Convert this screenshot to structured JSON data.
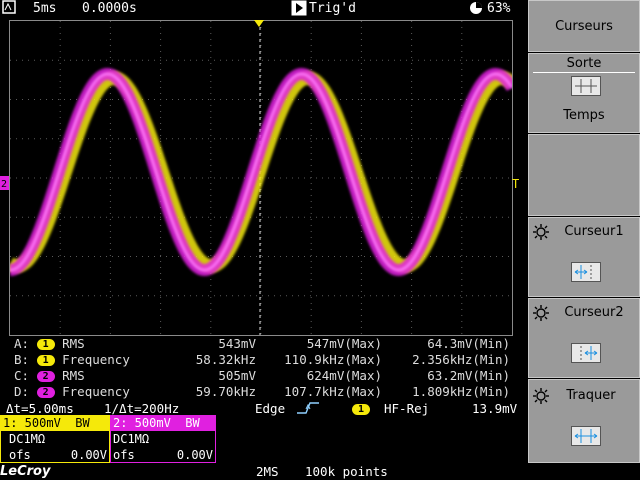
{
  "status": {
    "timebase": "5ms",
    "delay": "0.0000s",
    "trigger_state": "Trig'd",
    "battery": "63%"
  },
  "measurements": [
    {
      "letter": "A:",
      "channel": "1",
      "name": "RMS",
      "value": "543mV",
      "max": "547mV(Max)",
      "min": "64.3mV(Min)",
      "color": "#f5e90a"
    },
    {
      "letter": "B:",
      "channel": "1",
      "name": "Frequency",
      "value": "58.32kHz",
      "max": "110.9kHz(Max)",
      "min": "2.356kHz(Min)",
      "color": "#f5e90a"
    },
    {
      "letter": "C:",
      "channel": "2",
      "name": "RMS",
      "value": "505mV",
      "max": "624mV(Max)",
      "min": "63.2mV(Min)",
      "color": "#e020e0"
    },
    {
      "letter": "D:",
      "channel": "2",
      "name": "Frequency",
      "value": "59.70kHz",
      "max": "107.7kHz(Max)",
      "min": "1.809kHz(Min)",
      "color": "#e020e0"
    }
  ],
  "cursor_info": {
    "delta_t": "Δt=5.00ms",
    "inv_delta_t": "1/Δt=200Hz"
  },
  "trigger": {
    "type": "Edge",
    "source": "1",
    "coupling": "HF-Rej",
    "level": "13.9mV"
  },
  "channels": [
    {
      "header": "1: 500mV  BW",
      "coupling": "DC1MΩ",
      "offset_label": "ofs",
      "offset": "0.00V",
      "color": "#f5e90a"
    },
    {
      "header": "2: 500mV  BW",
      "coupling": "DC1MΩ",
      "offset_label": "ofs",
      "offset": "0.00V",
      "color": "#e020e0"
    }
  ],
  "brand": "LeCroy",
  "acquisition": {
    "sample_rate": "2MS",
    "points": "100k points"
  },
  "softkeys": {
    "title": "Curseurs",
    "type_label": "Sorte",
    "type_value": "Temps",
    "cursor1": "Curseur1",
    "cursor2": "Curseur2",
    "track": "Traquer"
  },
  "colors": {
    "ch1": "#f5e90a",
    "ch2": "#e020e0",
    "trigger_marker": "#f5e90a",
    "softkey_bg": "#9a9a9a"
  },
  "icons": [
    "play-icon",
    "battery-icon",
    "gear-icon",
    "cursor-time-icon",
    "cursor1-icon",
    "cursor2-icon",
    "track-icon",
    "trigger-edge-icon"
  ]
}
